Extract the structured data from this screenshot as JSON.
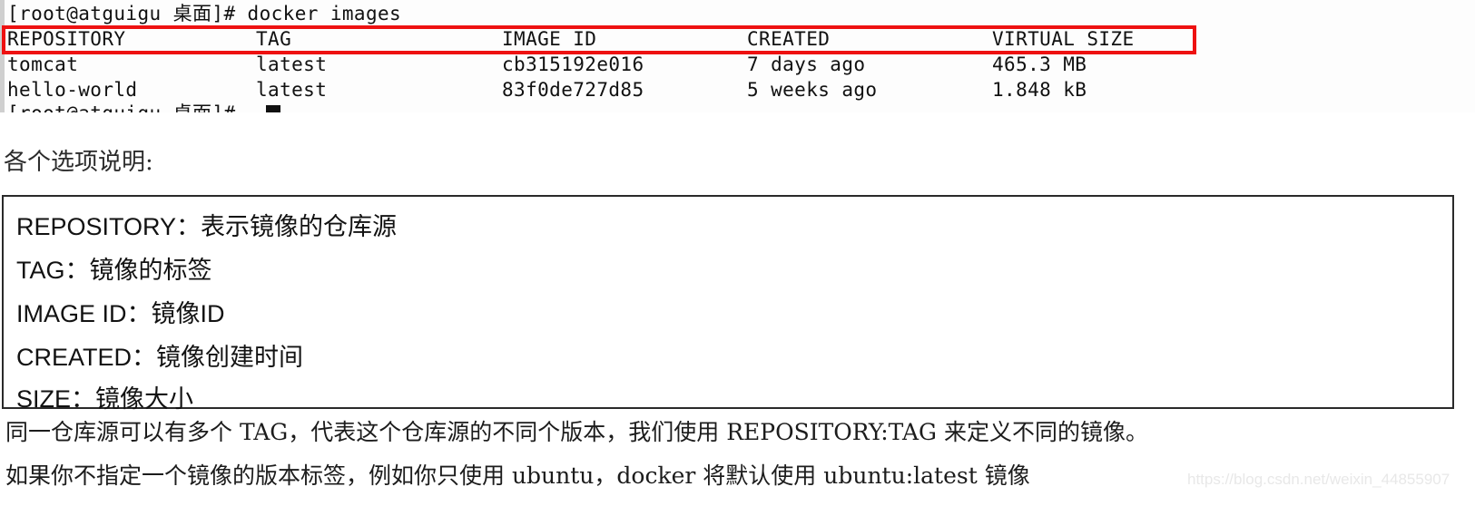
{
  "terminal": {
    "prompt_line": "[root@atguigu 桌面]# docker images",
    "columns": [
      "REPOSITORY",
      "TAG",
      "IMAGE ID",
      "CREATED",
      "VIRTUAL SIZE"
    ],
    "header": {
      "repository": "REPOSITORY",
      "tag": "TAG",
      "image_id": "IMAGE ID",
      "created": "CREATED",
      "virtual_size": "VIRTUAL SIZE"
    },
    "rows": [
      {
        "repository": "tomcat",
        "tag": "latest",
        "image_id": "cb315192e016",
        "created": "7 days ago",
        "virtual_size": "465.3 MB"
      },
      {
        "repository": "hello-world",
        "tag": "latest",
        "image_id": "83f0de727d85",
        "created": "5 weeks ago",
        "virtual_size": "1.848 kB"
      }
    ],
    "trailing_prompt": "[root@atguigu 桌面]#",
    "highlight_color": "#ee1111"
  },
  "options": {
    "heading": "各个选项说明:",
    "entries": [
      "REPOSITORY：表示镜像的仓库源",
      "TAG：镜像的标签",
      "IMAGE ID：镜像ID",
      "CREATED：镜像创建时间",
      "SIZE：镜像大小"
    ]
  },
  "paragraphs": [
    "同一仓库源可以有多个 TAG，代表这个仓库源的不同个版本，我们使用 REPOSITORY:TAG 来定义不同的镜像。",
    "如果你不指定一个镜像的版本标签，例如你只使用 ubuntu，docker 将默认使用 ubuntu:latest 镜像"
  ],
  "watermark": "https://blog.csdn.net/weixin_44855907"
}
